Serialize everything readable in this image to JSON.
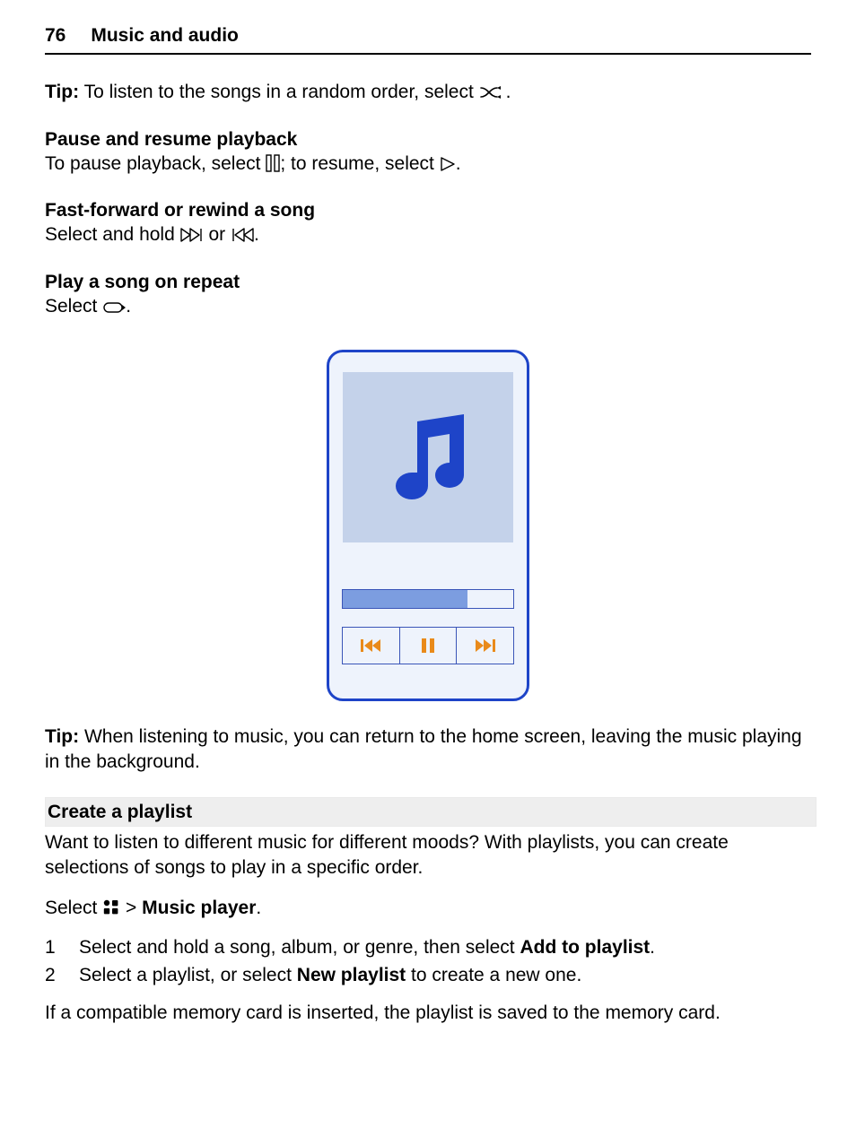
{
  "header": {
    "page_number": "76",
    "title": "Music and audio"
  },
  "tip_shuffle": {
    "label": "Tip:",
    "before": " To listen to the songs in a random order, select ",
    "after": "."
  },
  "pause_resume": {
    "heading": "Pause and resume playback",
    "before": "To pause playback, select ",
    "mid": "; to resume, select ",
    "after": "."
  },
  "fast_forward": {
    "heading": "Fast-forward or rewind a song",
    "before": "Select and hold ",
    "mid": " or ",
    "after": "."
  },
  "repeat": {
    "heading": "Play a song on repeat",
    "before": "Select ",
    "after": "."
  },
  "tip_background": {
    "label": "Tip:",
    "text": " When listening to music, you can return to the home screen, leaving the music playing in the background."
  },
  "create_playlist": {
    "heading": "Create a playlist",
    "intro": "Want to listen to different music for different moods? With playlists, you can create selections of songs to play in a specific order.",
    "select_line_before": "Select ",
    "select_line_chevron": " > ",
    "select_line_strong": "Music player",
    "select_line_after": ".",
    "steps": [
      {
        "n": "1",
        "before": "Select and hold a song, album, or genre, then select ",
        "strong": "Add to playlist",
        "after": "."
      },
      {
        "n": "2",
        "before": "Select a playlist, or select ",
        "strong": "New playlist",
        "after": " to create a new one."
      }
    ],
    "footnote": "If a compatible memory card is inserted, the playlist is saved to the memory card."
  }
}
